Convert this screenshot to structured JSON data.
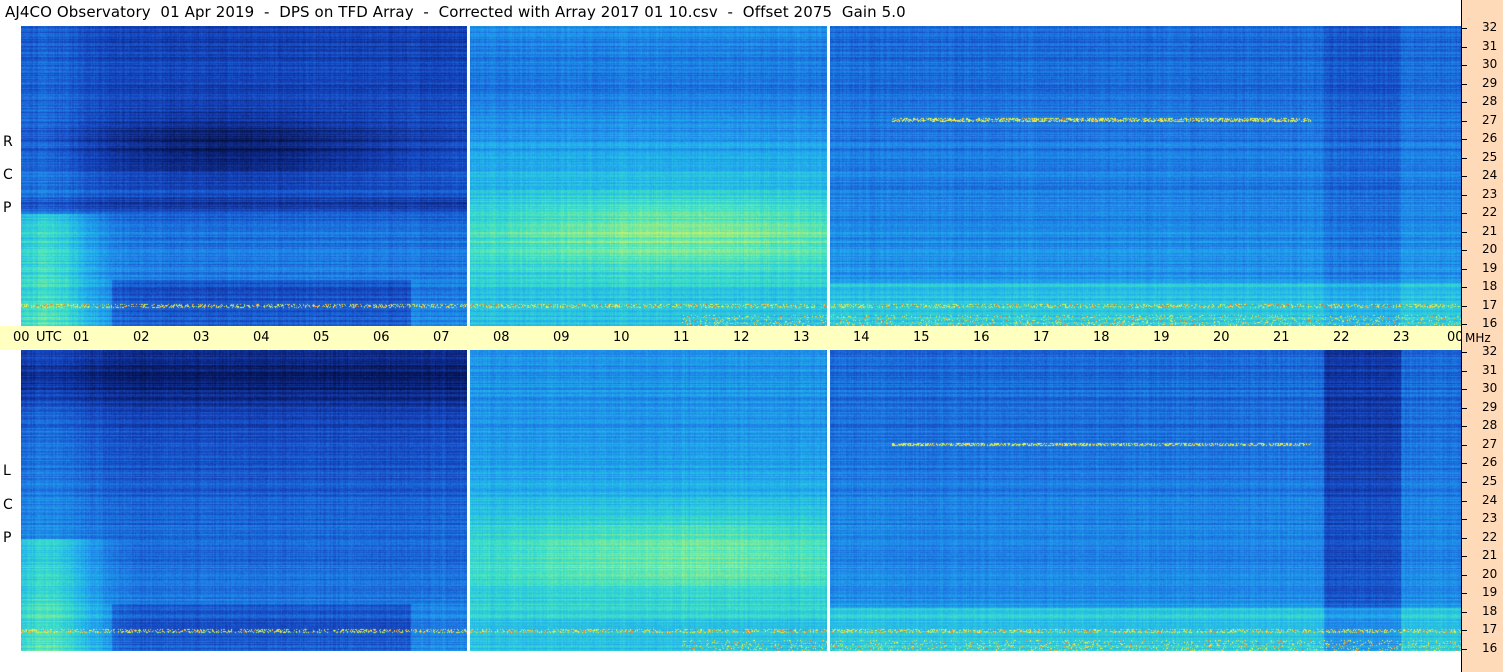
{
  "title": "AJ4CO Observatory  01 Apr 2019  -  DPS on TFD Array  -  Corrected with Array 2017 01 10.csv  -  Offset 2075  Gain 5.0",
  "chart_data": {
    "type": "heatmap",
    "title": "AJ4CO Observatory  01 Apr 2019  -  DPS on TFD Array  -  Corrected with Array 2017 01 10.csv  -  Offset 2075  Gain 5.0",
    "x_axis": {
      "labels": [
        "00",
        "UTC",
        "01",
        "02",
        "03",
        "04",
        "05",
        "06",
        "07",
        "08",
        "09",
        "10",
        "11",
        "12",
        "13",
        "14",
        "15",
        "16",
        "17",
        "18",
        "19",
        "20",
        "21",
        "22",
        "23",
        "00"
      ],
      "hours": [
        0,
        1,
        2,
        3,
        4,
        5,
        6,
        7,
        8,
        9,
        10,
        11,
        12,
        13,
        14,
        15,
        16,
        17,
        18,
        19,
        20,
        21,
        22,
        23,
        24
      ],
      "unit_label": "UTC",
      "xlim": [
        0,
        24
      ]
    },
    "y_axis": {
      "ticks": [
        32,
        31,
        30,
        29,
        28,
        27,
        26,
        25,
        24,
        23,
        22,
        21,
        20,
        19,
        18,
        17,
        16
      ],
      "unit_label": "MHz",
      "ylim": [
        16,
        32
      ]
    },
    "panels": [
      {
        "polarization": "R C P",
        "letters": [
          "R",
          "C",
          "P"
        ]
      },
      {
        "polarization": "L C P",
        "letters": [
          "L",
          "C",
          "P"
        ]
      }
    ],
    "gaps_hours": [
      7.45,
      13.45
    ],
    "colormap": [
      "#02061e",
      "#0a1e6e",
      "#1645c0",
      "#1e7ee6",
      "#22b4ec",
      "#3ce0c8",
      "#a8f07c",
      "#ffff40",
      "#ff6020"
    ],
    "grid": false,
    "legend": "none"
  }
}
